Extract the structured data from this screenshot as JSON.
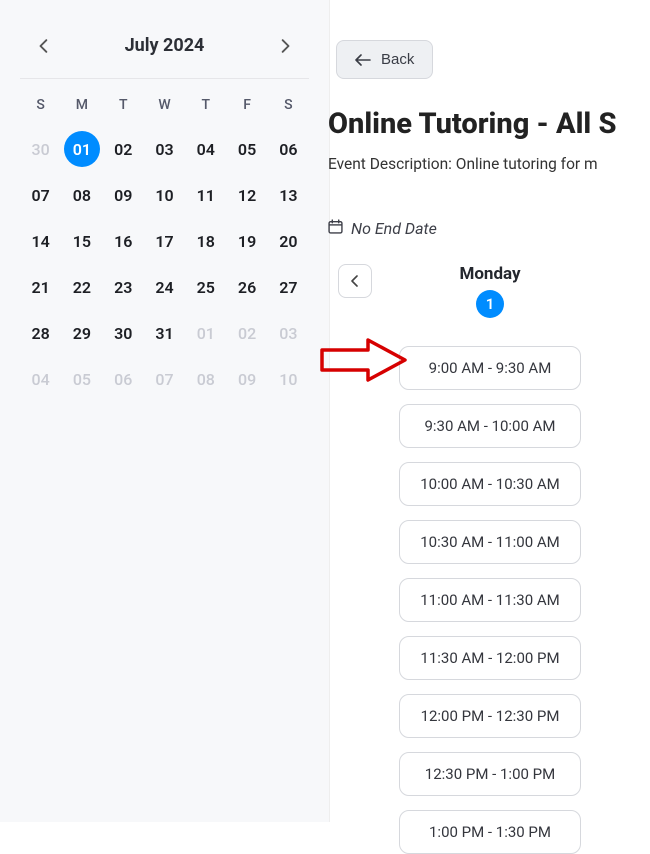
{
  "calendar": {
    "title": "July 2024",
    "dow": [
      "S",
      "M",
      "T",
      "W",
      "T",
      "F",
      "S"
    ],
    "cells": [
      {
        "n": "30",
        "other": true
      },
      {
        "n": "01",
        "other": false,
        "selected": true
      },
      {
        "n": "02",
        "other": false
      },
      {
        "n": "03",
        "other": false
      },
      {
        "n": "04",
        "other": false
      },
      {
        "n": "05",
        "other": false
      },
      {
        "n": "06",
        "other": false
      },
      {
        "n": "07",
        "other": false
      },
      {
        "n": "08",
        "other": false
      },
      {
        "n": "09",
        "other": false
      },
      {
        "n": "10",
        "other": false
      },
      {
        "n": "11",
        "other": false
      },
      {
        "n": "12",
        "other": false
      },
      {
        "n": "13",
        "other": false
      },
      {
        "n": "14",
        "other": false
      },
      {
        "n": "15",
        "other": false
      },
      {
        "n": "16",
        "other": false
      },
      {
        "n": "17",
        "other": false
      },
      {
        "n": "18",
        "other": false
      },
      {
        "n": "19",
        "other": false
      },
      {
        "n": "20",
        "other": false
      },
      {
        "n": "21",
        "other": false
      },
      {
        "n": "22",
        "other": false
      },
      {
        "n": "23",
        "other": false
      },
      {
        "n": "24",
        "other": false
      },
      {
        "n": "25",
        "other": false
      },
      {
        "n": "26",
        "other": false
      },
      {
        "n": "27",
        "other": false
      },
      {
        "n": "28",
        "other": false
      },
      {
        "n": "29",
        "other": false
      },
      {
        "n": "30",
        "other": false
      },
      {
        "n": "31",
        "other": false
      },
      {
        "n": "01",
        "other": true
      },
      {
        "n": "02",
        "other": true
      },
      {
        "n": "03",
        "other": true
      },
      {
        "n": "04",
        "other": true
      },
      {
        "n": "05",
        "other": true
      },
      {
        "n": "06",
        "other": true
      },
      {
        "n": "07",
        "other": true
      },
      {
        "n": "08",
        "other": true
      },
      {
        "n": "09",
        "other": true
      },
      {
        "n": "10",
        "other": true
      }
    ]
  },
  "back_label": "Back",
  "title": "Online Tutoring - All S",
  "description": "Event Description: Online tutoring for m",
  "no_end_date_label": "No End Date",
  "selected_day": {
    "name": "Monday",
    "num": "1"
  },
  "slots": [
    "9:00 AM - 9:30 AM",
    "9:30 AM - 10:00 AM",
    "10:00 AM - 10:30 AM",
    "10:30 AM - 11:00 AM",
    "11:00 AM - 11:30 AM",
    "11:30 AM - 12:00 PM",
    "12:00 PM - 12:30 PM",
    "12:30 PM - 1:00 PM",
    "1:00 PM - 1:30 PM"
  ]
}
